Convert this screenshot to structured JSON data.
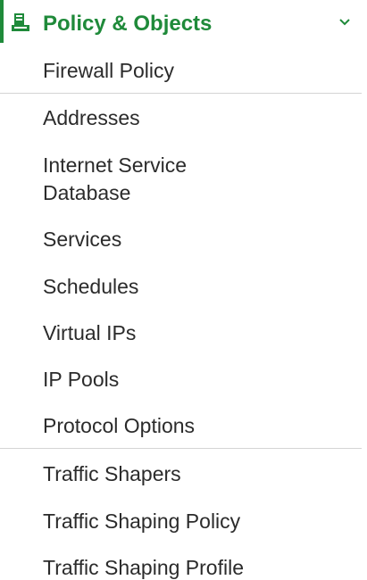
{
  "section": {
    "title": "Policy & Objects",
    "icon": "policy-objects-icon",
    "chevron_icon": "chevron-down-icon",
    "accent_color": "#1f8a3a"
  },
  "items": [
    {
      "label": "Firewall Policy"
    },
    {
      "label": "Addresses"
    },
    {
      "label": "Internet Service"
    },
    {
      "label": "Database"
    },
    {
      "label": "Services"
    },
    {
      "label": "Schedules"
    },
    {
      "label": "Virtual IPs"
    },
    {
      "label": "IP Pools"
    },
    {
      "label": "Protocol Options"
    },
    {
      "label": "Traffic Shapers"
    },
    {
      "label": "Traffic Shaping Policy"
    },
    {
      "label": "Traffic Shaping Profile"
    }
  ]
}
